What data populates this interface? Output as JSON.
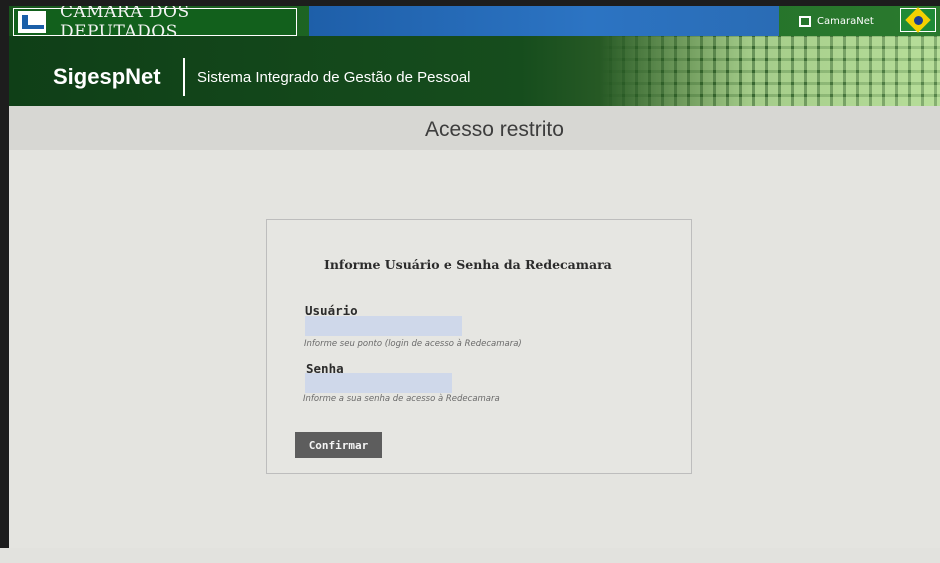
{
  "org": {
    "name": "CÂMARA DOS DEPUTADOS"
  },
  "toplinks": {
    "camaranet": "CamaraNet"
  },
  "system": {
    "brand": "SigespNet",
    "name": "Sistema Integrado de Gestão de Pessoal"
  },
  "page": {
    "title": "Acesso restrito"
  },
  "login": {
    "heading": "Informe Usuário e Senha da Redecamara",
    "user_label": "Usuário",
    "user_hint": "Informe seu ponto (login de acesso à Redecamara)",
    "password_label": "Senha",
    "password_hint": "Informe a sua senha de acesso à Redecamara",
    "submit_label": "Confirmar"
  },
  "icons": {
    "org_logo": "camara-logo-icon",
    "camaranet": "external-link-icon",
    "flag": "brazil-flag-icon"
  },
  "colors": {
    "top_green": "#18551d",
    "top_blue": "#2c74c3",
    "header_green": "#0f3f17",
    "button_gray": "#5d5d5d",
    "input_fill": "#cfd8ea"
  }
}
